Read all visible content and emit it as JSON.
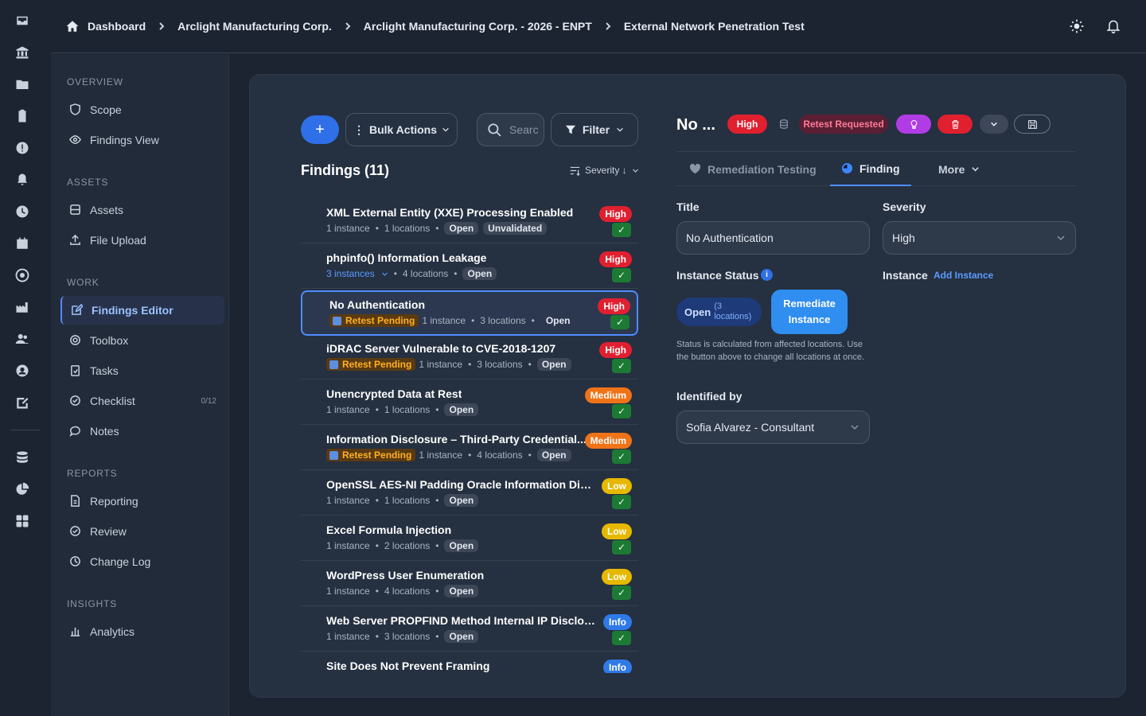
{
  "breadcrumbs": [
    "Dashboard",
    "Arclight Manufacturing Corp.",
    "Arclight Manufacturing Corp. - 2026 - ENPT",
    "External Network Penetration Test"
  ],
  "sidebar": {
    "sections": {
      "overview": "OVERVIEW",
      "assets": "ASSETS",
      "work": "WORK",
      "reports": "REPORTS",
      "insights": "INSIGHTS"
    },
    "items": {
      "scope": "Scope",
      "findings_view": "Findings View",
      "assets": "Assets",
      "file_upload": "File Upload",
      "findings_editor": "Findings Editor",
      "toolbox": "Toolbox",
      "tasks": "Tasks",
      "checklist": "Checklist",
      "checklist_count": "0/12",
      "notes": "Notes",
      "reporting": "Reporting",
      "review": "Review",
      "change_log": "Change Log",
      "analytics": "Analytics"
    }
  },
  "toolbar": {
    "add_label": "+",
    "bulk_actions_label": "Bulk Actions",
    "search_placeholder": "Searc",
    "filter_label": "Filter",
    "findings_title": "Findings (11)",
    "sort_label": "Severity ↓"
  },
  "findings": [
    {
      "title": "XML External Entity (XXE) Processing Enabled",
      "instances": "1 instance",
      "locations": "1 locations",
      "status": "Open",
      "extra": "Unvalidated",
      "severity": "High",
      "check": "✓"
    },
    {
      "title": "phpinfo() Information Leakage",
      "instances": "3 instances",
      "locations": "4 locations",
      "status": "Open",
      "severity": "High",
      "check": "✓"
    },
    {
      "title": "No Authentication",
      "retest": "Retest Pending",
      "instances": "1 instance",
      "locations": "3 locations",
      "status": "Open",
      "severity": "High",
      "check": "✓"
    },
    {
      "title": "iDRAC Server Vulnerable to CVE-2018-1207",
      "retest": "Retest Pending",
      "instances": "1 instance",
      "locations": "3 locations",
      "status": "Open",
      "severity": "High",
      "check": "✓"
    },
    {
      "title": "Unencrypted Data at Rest",
      "instances": "1 instance",
      "locations": "1 locations",
      "status": "Open",
      "severity": "Medium",
      "check": "✓"
    },
    {
      "title": "Information Disclosure – Third-Party Credential...",
      "retest": "Retest Pending",
      "instances": "1 instance",
      "locations": "4 locations",
      "status": "Open",
      "severity": "Medium",
      "check": "✓"
    },
    {
      "title": "OpenSSL AES-NI Padding Oracle Information Discl...",
      "instances": "1 instance",
      "locations": "1 locations",
      "status": "Open",
      "severity": "Low",
      "check": "✓"
    },
    {
      "title": "Excel Formula Injection",
      "instances": "1 instance",
      "locations": "2 locations",
      "status": "Open",
      "severity": "Low",
      "check": "✓"
    },
    {
      "title": "WordPress User Enumeration",
      "instances": "1 instance",
      "locations": "4 locations",
      "status": "Open",
      "severity": "Low",
      "check": "✓"
    },
    {
      "title": "Web Server PROPFIND Method Internal IP Disclosure",
      "instances": "1 instance",
      "locations": "3 locations",
      "status": "Open",
      "severity": "Info",
      "check": "✓"
    },
    {
      "title": "Site Does Not Prevent Framing",
      "severity": "Info"
    }
  ],
  "detail": {
    "name": "No ...",
    "severity_pill": "High",
    "retest_pill": "Retest Requested",
    "tabs": {
      "remediation": "Remediation Testing",
      "finding": "Finding",
      "more": "More"
    },
    "title_label": "Title",
    "title_value": "No Authentication",
    "severity_label": "Severity",
    "severity_value": "High",
    "instance_status_label": "Instance Status",
    "status_open": "Open",
    "status_locations": "(3 locations)",
    "remediate_label": "Remediate Instance",
    "instance_label": "Instance",
    "add_instance_label": "Add Instance",
    "help_text": "Status is calculated from affected locations. Use the button above to change all locations at once.",
    "identified_by_label": "Identified by",
    "identified_by_value": "Sofia Alvarez - Consultant"
  },
  "colors": {
    "accent": "#2f6fe8",
    "high": "#e0202f",
    "medium": "#f07318",
    "low": "#e6b800",
    "info": "#2f7ae8",
    "retest": "#ffb020",
    "validated": "#1d7a34"
  }
}
